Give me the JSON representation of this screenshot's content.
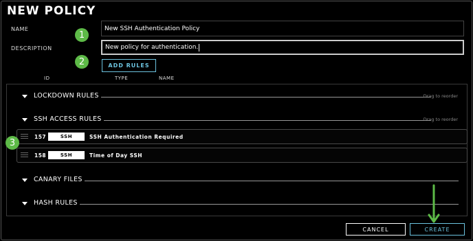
{
  "dialog": {
    "title": "NEW POLICY"
  },
  "form": {
    "name_label": "NAME",
    "name_value": "New SSH Authentication Policy",
    "description_label": "DESCRIPTION",
    "description_value": "New policy for authentication."
  },
  "add_rules_label": "ADD RULES",
  "columns": {
    "id": "ID",
    "type": "TYPE",
    "name": "NAME"
  },
  "sections": {
    "lockdown": {
      "title": "LOCKDOWN RULES",
      "hint": "Drag to reorder"
    },
    "ssh_access": {
      "title": "SSH ACCESS RULES",
      "hint": "Drag to reorder",
      "rules": [
        {
          "id": "157",
          "type": "SSH",
          "name": "SSH Authentication Required"
        },
        {
          "id": "158",
          "type": "SSH",
          "name": "Time of Day SSH"
        }
      ]
    },
    "canary": {
      "title": "CANARY FILES"
    },
    "hash": {
      "title": "HASH RULES"
    }
  },
  "footer": {
    "cancel_label": "CANCEL",
    "create_label": "CREATE"
  },
  "annotations": {
    "step1": "1",
    "step2": "2",
    "step3": "3"
  },
  "colors": {
    "accent": "#6cc4e0",
    "annotation": "#5dba47",
    "background": "#000000"
  }
}
